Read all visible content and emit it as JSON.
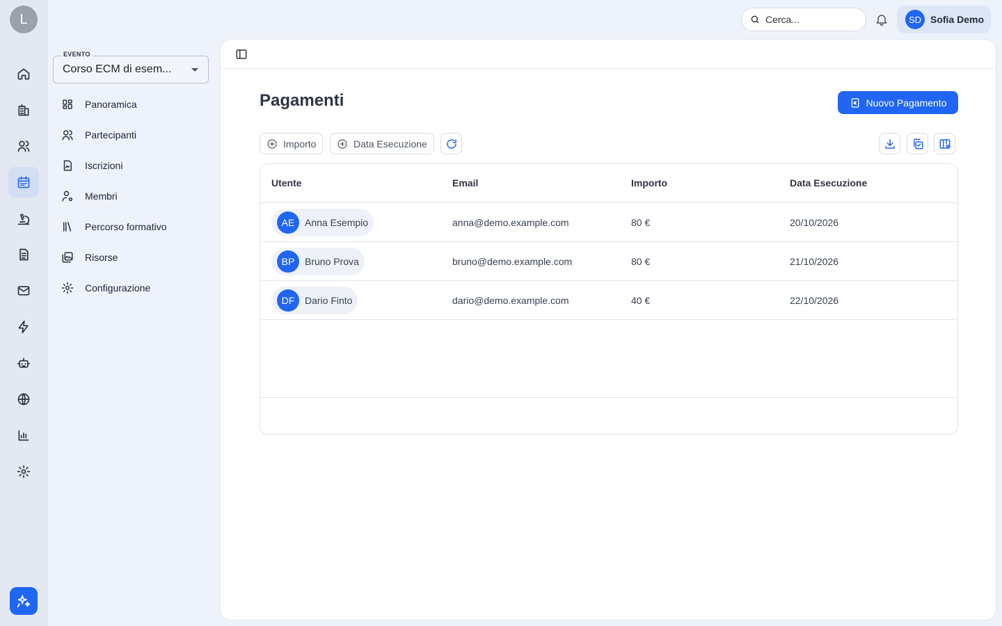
{
  "rail": {
    "logo_letter": "L",
    "items": [
      {
        "icon": "home-icon",
        "active": false
      },
      {
        "icon": "building-icon",
        "active": false
      },
      {
        "icon": "users-icon",
        "active": false
      },
      {
        "icon": "calendar-icon",
        "active": true
      },
      {
        "icon": "microscope-icon",
        "active": false
      },
      {
        "icon": "document-icon",
        "active": false
      },
      {
        "icon": "mail-icon",
        "active": false
      },
      {
        "icon": "lightning-icon",
        "active": false
      },
      {
        "icon": "robot-icon",
        "active": false
      },
      {
        "icon": "globe-icon",
        "active": false
      },
      {
        "icon": "bar-chart-icon",
        "active": false
      },
      {
        "icon": "gear-icon",
        "active": false
      }
    ],
    "assistant_icon": "sparkles-icon"
  },
  "sidebar": {
    "event_label": "EVENTO",
    "event_value": "Corso ECM di esem...",
    "items": [
      {
        "label": "Panoramica",
        "icon": "grid-icon"
      },
      {
        "label": "Partecipanti",
        "icon": "users-icon"
      },
      {
        "label": "Iscrizioni",
        "icon": "signature-icon"
      },
      {
        "label": "Membri",
        "icon": "user-settings-icon"
      },
      {
        "label": "Percorso formativo",
        "icon": "library-icon"
      },
      {
        "label": "Risorse",
        "icon": "images-icon"
      },
      {
        "label": "Configurazione",
        "icon": "gear-icon"
      }
    ]
  },
  "topbar": {
    "search_placeholder": "Cerca...",
    "user_initials": "SD",
    "user_name": "Sofia Demo"
  },
  "main": {
    "title": "Pagamenti",
    "new_button": "Nuovo Pagamento",
    "filters": [
      "Importo",
      "Data Esecuzione"
    ],
    "columns": [
      "Utente",
      "Email",
      "Importo",
      "Data Esecuzione"
    ],
    "rows": [
      {
        "initials": "AE",
        "name": "Anna Esempio",
        "email": "anna@demo.example.com",
        "amount": "80 €",
        "date": "20/10/2026"
      },
      {
        "initials": "BP",
        "name": "Bruno Prova",
        "email": "bruno@demo.example.com",
        "amount": "80 €",
        "date": "21/10/2026"
      },
      {
        "initials": "DF",
        "name": "Dario Finto",
        "email": "dario@demo.example.com",
        "amount": "40 €",
        "date": "22/10/2026"
      }
    ]
  },
  "colors": {
    "accent": "#2166f3",
    "background": "#eef2fa",
    "active_rail": "#d3def4"
  }
}
